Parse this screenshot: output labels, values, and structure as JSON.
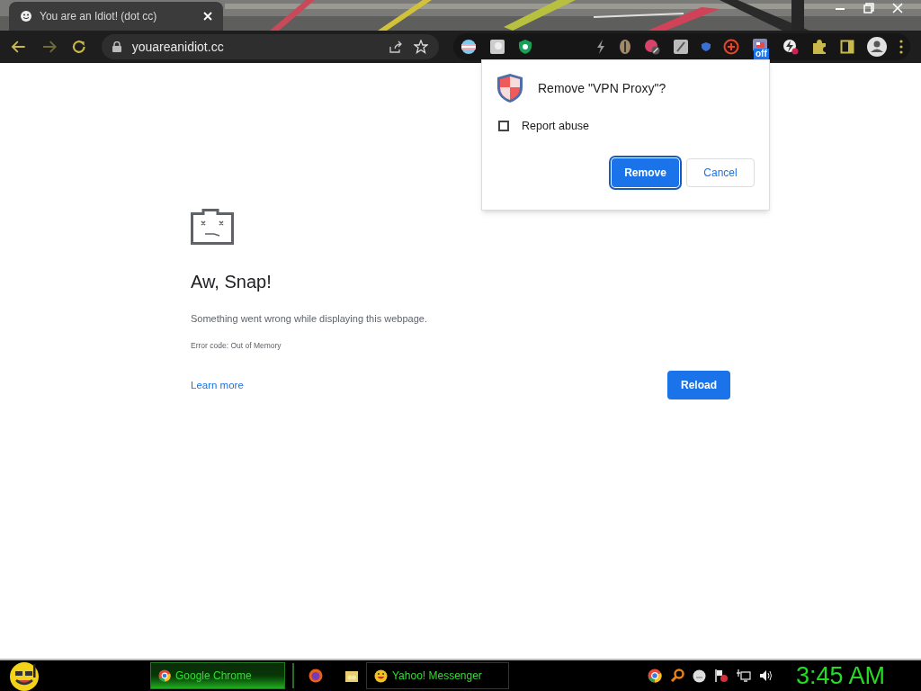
{
  "browser": {
    "tab_title": "You are an Idiot! (dot cc)",
    "url": "youareanidiot.cc",
    "extension_badge": "off"
  },
  "dialog": {
    "title": "Remove \"VPN Proxy\"?",
    "checkbox": {
      "label": "Report abuse",
      "checked": false
    },
    "buttons": [
      {
        "label": "Remove",
        "kind": "primary"
      },
      {
        "label": "Cancel",
        "kind": "secondary"
      }
    ]
  },
  "error_page": {
    "heading": "Aw, Snap!",
    "message": "Something went wrong while displaying this webpage.",
    "error_code": "Error code: Out of Memory",
    "link": "Learn more",
    "button": "Reload"
  },
  "taskbar": {
    "buttons": [
      {
        "label": "Google Chrome",
        "selected": true,
        "kind": "chrome"
      },
      {
        "label": "Yahoo! Messenger",
        "selected": false,
        "kind": "messenger"
      }
    ],
    "clock": "3:45 AM"
  }
}
